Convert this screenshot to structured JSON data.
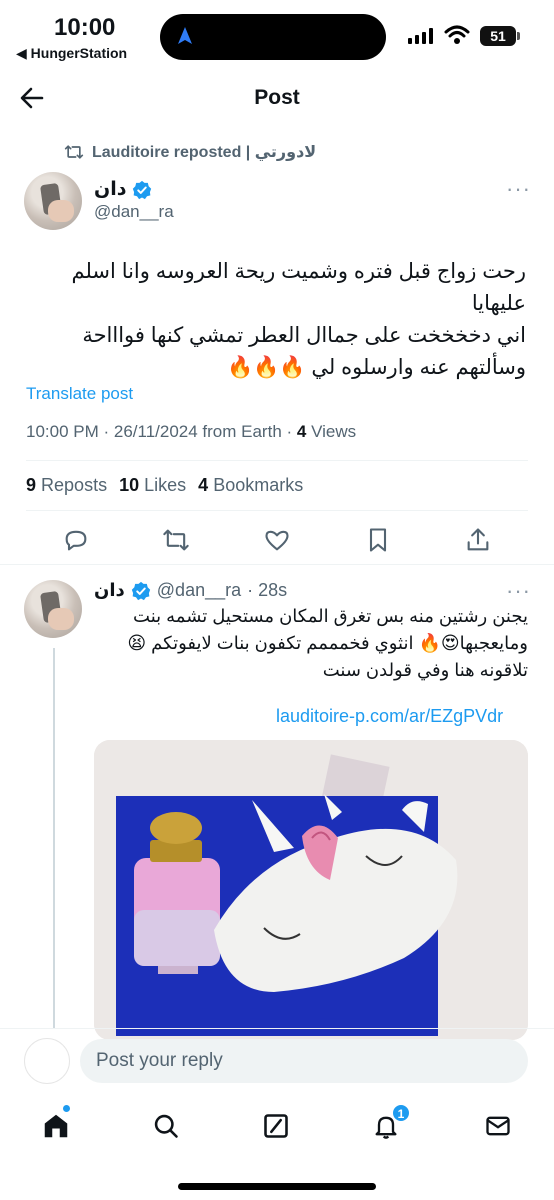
{
  "status_bar": {
    "time": "10:00",
    "back_app": "◀ HungerStation",
    "battery": "51"
  },
  "header": {
    "title": "Post"
  },
  "repost": {
    "text": "Lauditoire reposted | لادورتي"
  },
  "tweet": {
    "author_name": "دان",
    "author_handle": "@dan__ra",
    "text_line1": "رحت زواج قبل فتره وشميت ريحة العروسه وانا اسلم عليهايا",
    "text_line2": "اني دخخخخت على جماال العطر تمشي كنها فواااحة",
    "text_line3": "وسألتهم عنه وارسلوه لي 🔥🔥🔥",
    "translate": "Translate post",
    "timestamp": "10:00 PM · 26/11/2024 from Earth · ",
    "views_count": "4",
    "views_label": " Views"
  },
  "stats": {
    "reposts_count": "9",
    "reposts_label": "Reposts",
    "likes_count": "10",
    "likes_label": "Likes",
    "bookmarks_count": "4",
    "bookmarks_label": "Bookmarks"
  },
  "actions": [
    "reply-icon",
    "repost-icon",
    "like-icon",
    "bookmark-icon",
    "share-icon"
  ],
  "reply": {
    "author_name": "دان",
    "author_handle": "@dan__ra",
    "time": "· 28s",
    "line1": "يجنن رشتين منه بس تغرق المكان مستحيل تشمه بنت",
    "line2": "ومايعجبها😍🔥 انثوي فخمممم تكفون بنات لايفوتكم 😫",
    "line3": "تلاقونه هنا وفي قولدن سنت",
    "link": "lauditoire-p.com/ar/EZgPVdr"
  },
  "composer": {
    "placeholder": "Post your reply"
  },
  "nav": {
    "items": [
      "home-icon",
      "search-icon",
      "grok-icon",
      "notifications-icon",
      "messages-icon"
    ],
    "notification_badge": "1"
  },
  "colors": {
    "accent": "#1d9bf0",
    "secondary_text": "#536471",
    "primary_text": "#0f1419"
  }
}
